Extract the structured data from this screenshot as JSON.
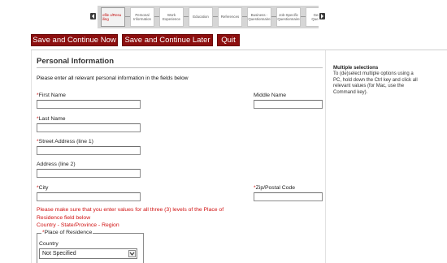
{
  "wizard": {
    "steps": [
      {
        "label": "ofile o/Resu iling",
        "current": true
      },
      {
        "label": "Personal Information",
        "current": false
      },
      {
        "label": "Work Experience",
        "current": false
      },
      {
        "label": "Education",
        "current": false
      },
      {
        "label": "References",
        "current": false
      },
      {
        "label": "Business - Questionnaire",
        "current": false
      },
      {
        "label": "Job-Specific Questionnaire",
        "current": false
      },
      {
        "label": "Gene Questio",
        "current": false
      }
    ]
  },
  "actions": {
    "save_now": "Save and Continue Now",
    "save_later": "Save and Continue Later",
    "quit": "Quit"
  },
  "section": {
    "title": "Personal Information",
    "intro": "Please enter all relevant personal information in the fields below"
  },
  "fields": {
    "first_name": {
      "label": "First Name",
      "value": ""
    },
    "middle_name": {
      "label": "Middle Name",
      "value": ""
    },
    "last_name": {
      "label": "Last Name",
      "value": ""
    },
    "street1": {
      "label": "Street Address (line 1)",
      "value": ""
    },
    "street2": {
      "label": "Address (line 2)",
      "value": ""
    },
    "city": {
      "label": "City",
      "value": ""
    },
    "zip": {
      "label": "Zip/Postal Code",
      "value": ""
    }
  },
  "required_marker": "*",
  "warning": {
    "line1": "Please make sure that you enter values for all three (3) levels of the Place of Residence field below",
    "line2": "Country - State/Province - Region"
  },
  "residence": {
    "legend": "Place of Residence",
    "country_label": "Country",
    "country_value": "Not Specified"
  },
  "help": {
    "title": "Multiple selections",
    "body": "To (de)select multiple options using a PC, hold down the Ctrl key and click all relevant values (for Mac, use the Command key)."
  },
  "colors": {
    "button_bg": "#8c0f0f",
    "required": "#d01010"
  }
}
